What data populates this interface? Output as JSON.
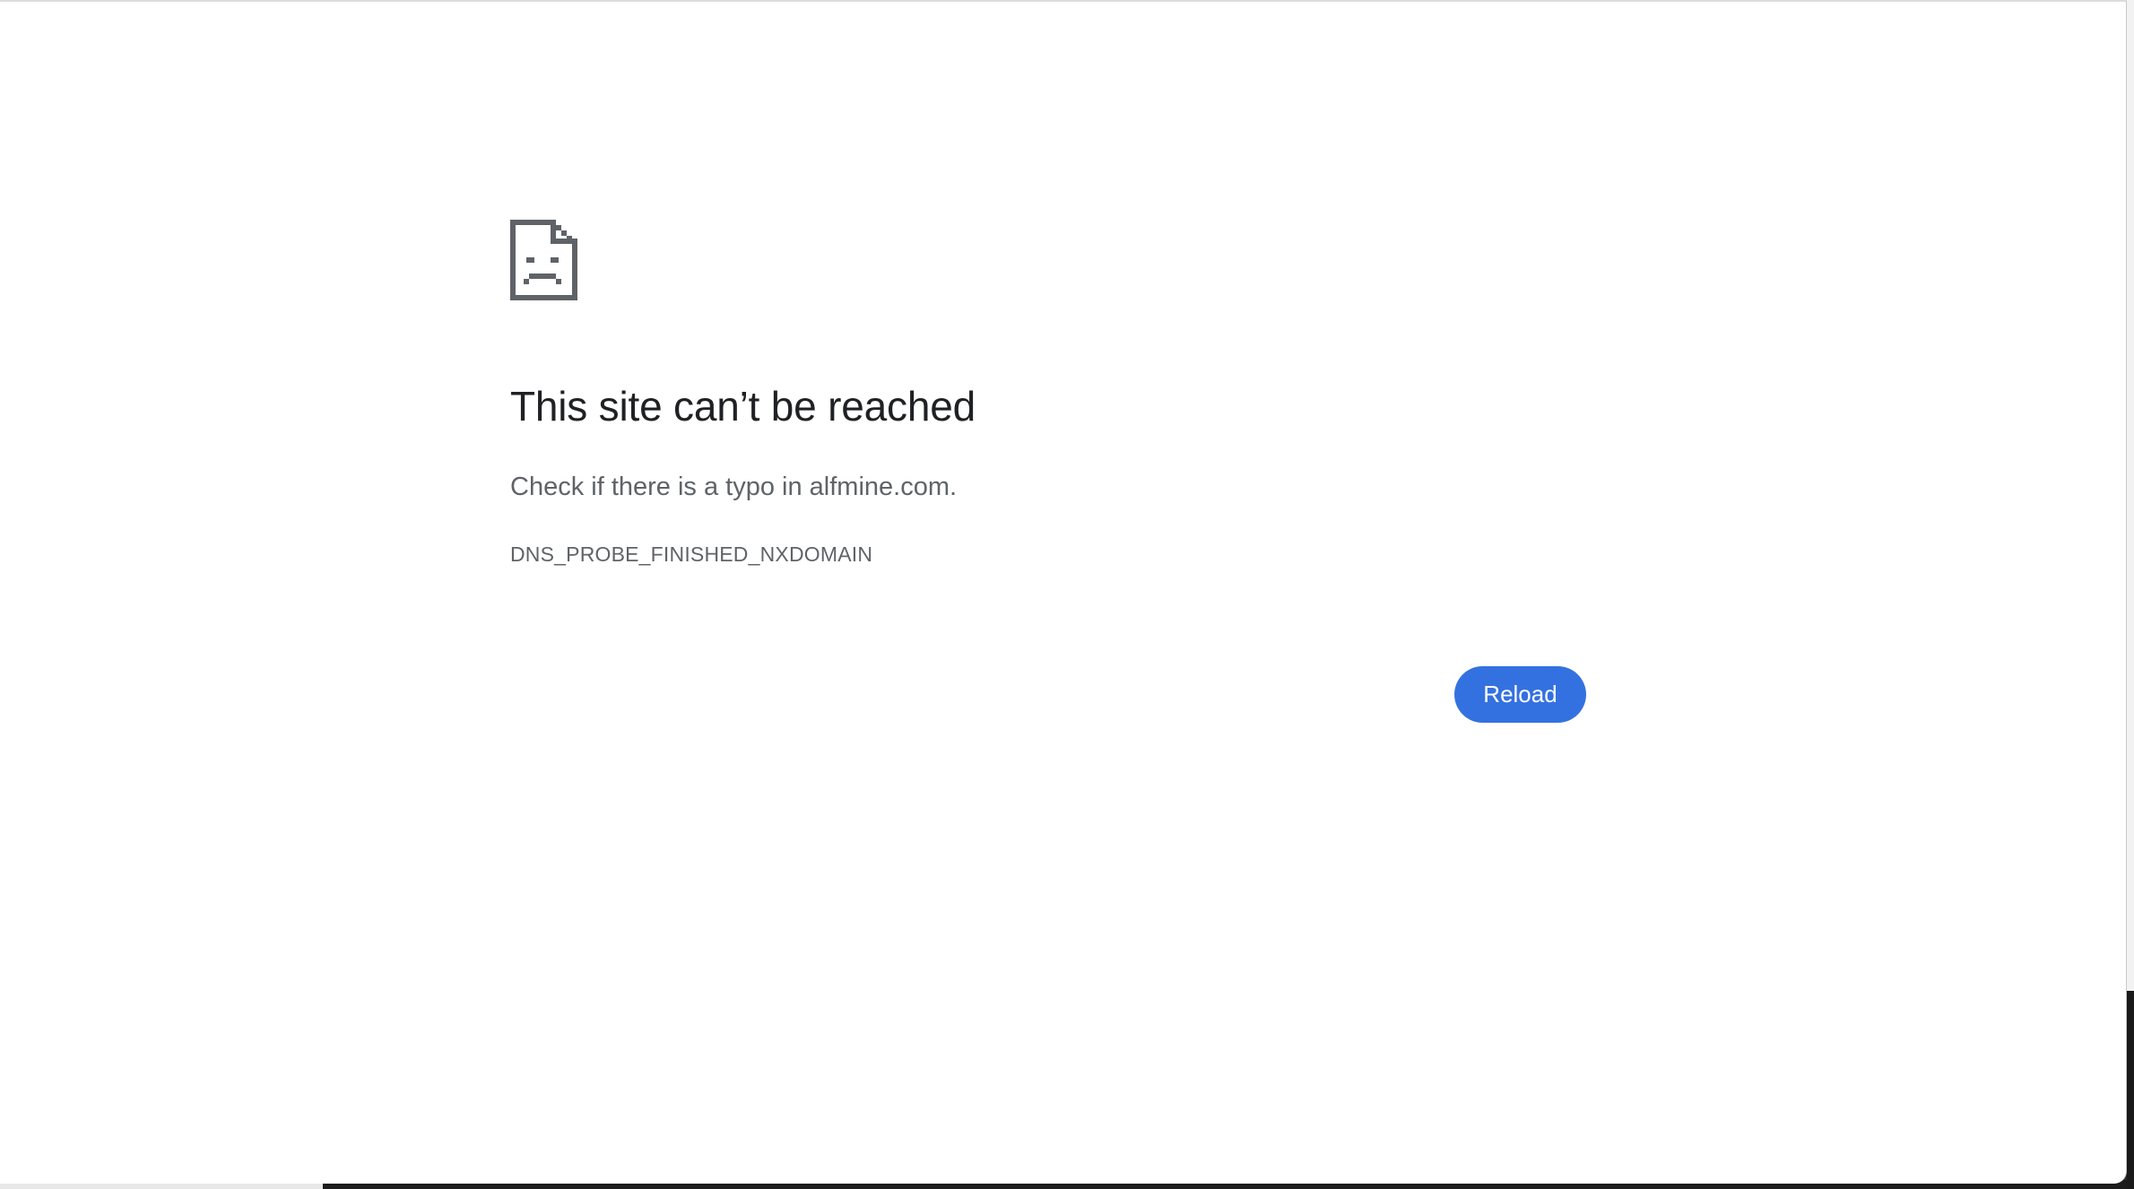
{
  "error_page": {
    "icon": "sad-page-icon",
    "headline": "This site can’t be reached",
    "suggestion": "Check if there is a typo in alfmine.com.",
    "error_code": "DNS_PROBE_FINISHED_NXDOMAIN",
    "reload_label": "Reload"
  },
  "colors": {
    "accent": "#3471e0",
    "headline": "#202124",
    "secondary_text": "#5f6368",
    "icon": "#5f6368"
  }
}
